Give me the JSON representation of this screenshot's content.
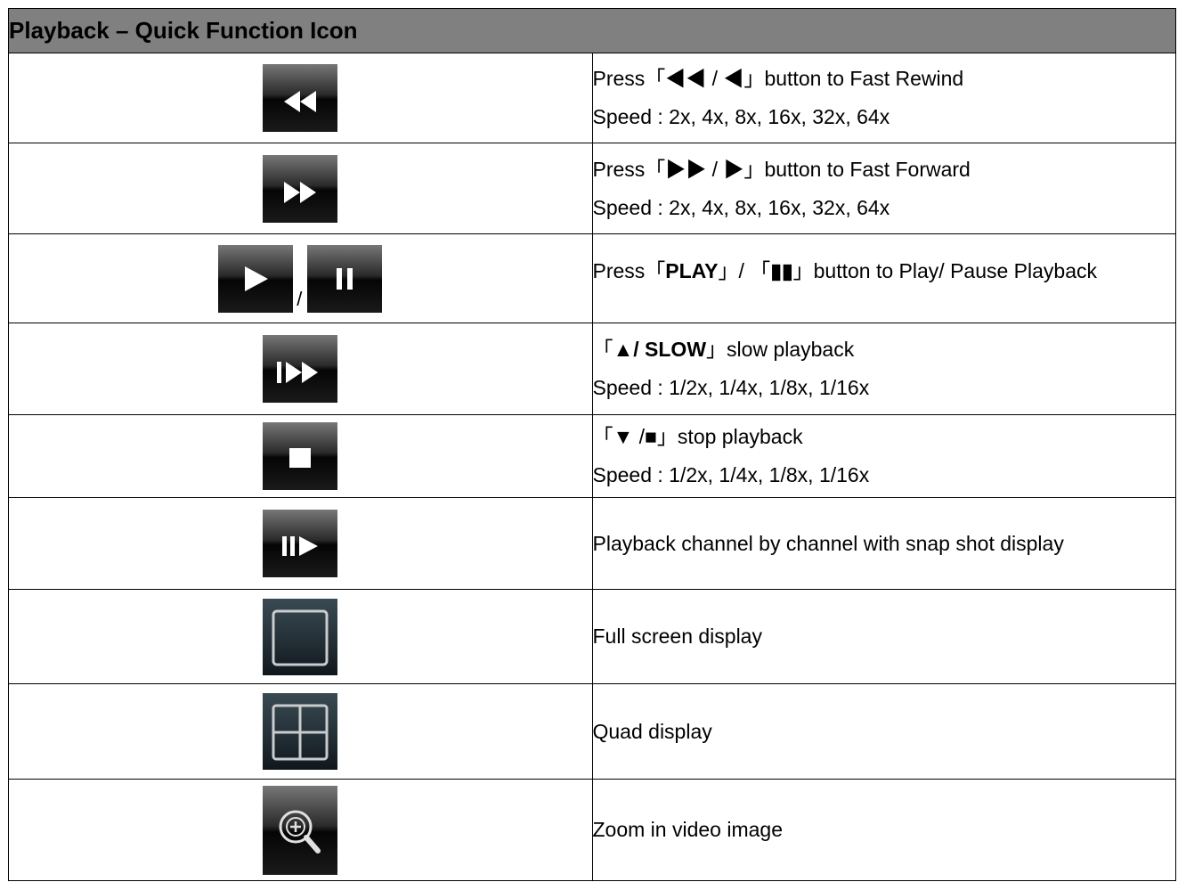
{
  "header": {
    "title": "Playback – Quick Function Icon"
  },
  "rows": [
    {
      "icon": "fast-rewind-icon",
      "line1": "Press「◀◀ / ◀」button to Fast Rewind",
      "line2": "Speed : 2x, 4x, 8x, 16x, 32x, 64x"
    },
    {
      "icon": "fast-forward-icon",
      "line1": "Press「▶▶ / ▶」button to Fast Forward",
      "line2": "Speed : 2x, 4x, 8x, 16x, 32x, 64x"
    },
    {
      "icon": "play-pause-icons",
      "icon_separator": "/",
      "line1_pre": "Press「",
      "line1_bold1": "PLAY",
      "line1_mid": "」/ 「",
      "line1_bold2": "▮▮",
      "line1_post": "」button to Play/ Pause Playback"
    },
    {
      "icon": "slow-playback-icon",
      "line1_pre": "「",
      "line1_bold": "▲/ SLOW",
      "line1_post": "」slow playback",
      "line2": "Speed : 1/2x, 1/4x, 1/8x, 1/16x"
    },
    {
      "icon": "stop-icon",
      "line1": "「▼ /■」stop playback",
      "line2": "Speed : 1/2x, 1/4x, 1/8x, 1/16x"
    },
    {
      "icon": "step-play-icon",
      "line1": "Playback channel by channel with snap shot display"
    },
    {
      "icon": "full-screen-icon",
      "line1": "Full screen display"
    },
    {
      "icon": "quad-display-icon",
      "line1": "Quad display"
    },
    {
      "icon": "zoom-in-icon",
      "line1": "Zoom in video image"
    }
  ]
}
